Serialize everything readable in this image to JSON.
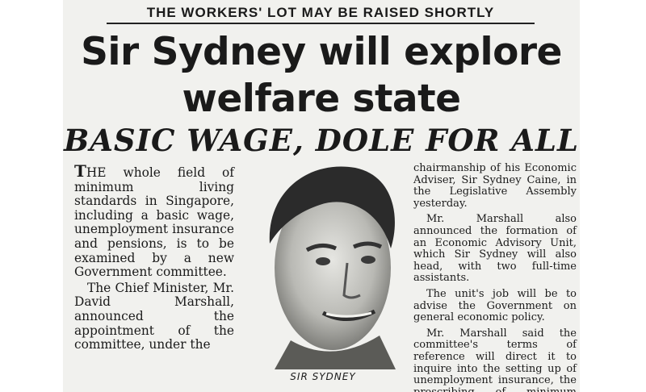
{
  "kicker": "THE WORKERS' LOT MAY BE RAISED SHORTLY",
  "headline": {
    "line1": "Sir Sydney will explore",
    "line2": "welfare state"
  },
  "subhead": "BASIC WAGE, DOLE FOR ALL",
  "left_column": {
    "dropcap": "T",
    "para1": "HE whole field of minimum living standards in Singapore, including a basic wage, unemployment insurance and pensions, is to be examined by a new Government committee.",
    "para2": "The Chief Minister, Mr. David Marshall, announced the appointment of the committee, under the"
  },
  "right_column": {
    "para1": "chairmanship of his Economic Adviser, Sir Sydney Caine, in the Legislative Assembly yesterday.",
    "para2": "Mr. Marshall also announced the formation of an Economic Advisory Unit, which Sir Sydney will also head, with two full-time assistants.",
    "para3": "The unit's job will be to advise the Government on general economic policy.",
    "para4": "Mr. Marshall said the committee's terms of reference will direct it to inquire into the setting up of unemployment insurance, the prescribing of minimum wages, either"
  },
  "photo_caption": "SIR SYDNEY"
}
